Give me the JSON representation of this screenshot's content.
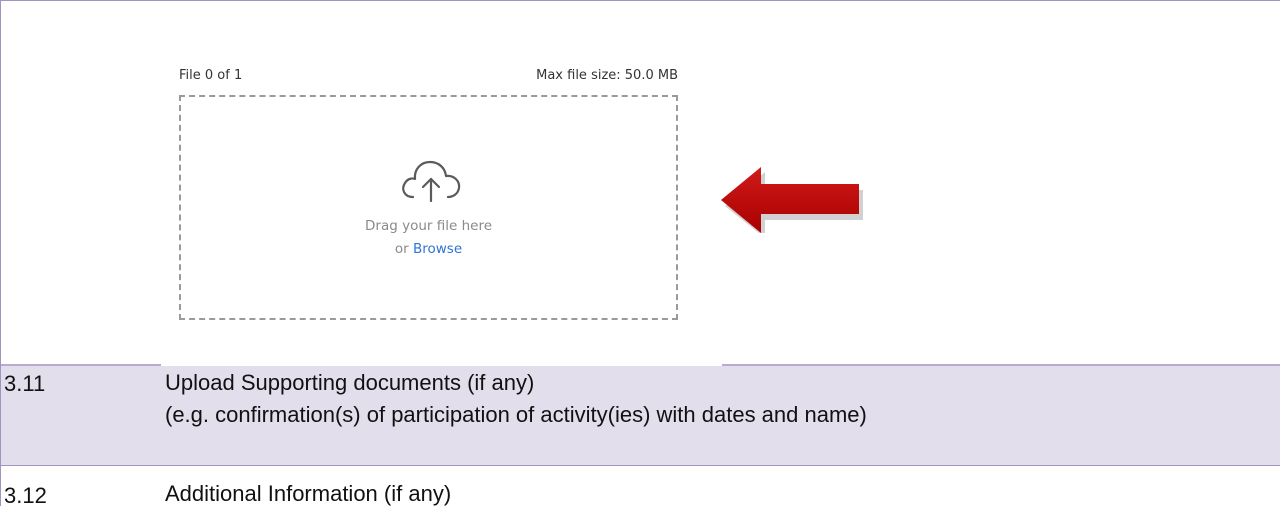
{
  "upload": {
    "file_count": "File 0 of 1",
    "max_size": "Max file size: 50.0 MB",
    "drag_text": "Drag your file here",
    "or_text": "or",
    "browse_label": "Browse",
    "icon": "cloud-upload-icon"
  },
  "annotation": {
    "icon": "red-arrow-left-icon",
    "color": "#c00000"
  },
  "rows": [
    {
      "number": "3.11",
      "line1": "Upload Supporting documents (if any)",
      "line2": "(e.g. confirmation(s) of participation of activity(ies) with dates and name)"
    },
    {
      "number": "3.12",
      "line1": "Additional Information (if any)"
    }
  ],
  "colors": {
    "row_highlight": "#e2deec",
    "border": "#a393bf",
    "link": "#2f73d8"
  }
}
